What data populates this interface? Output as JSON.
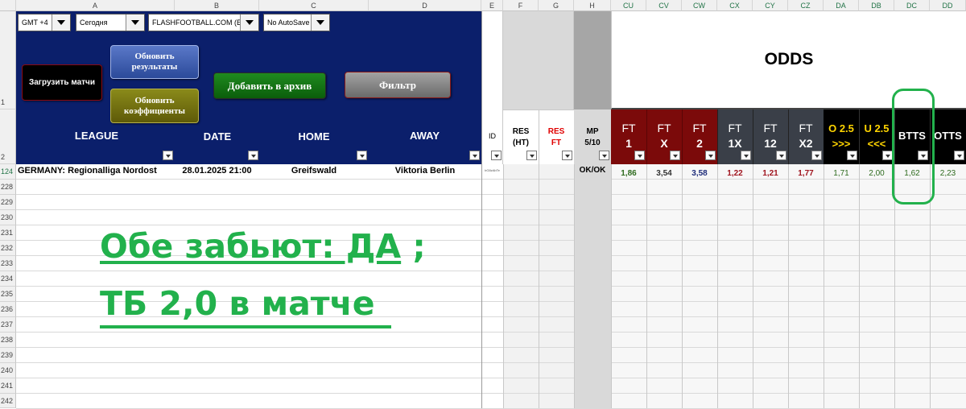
{
  "column_headers": [
    "A",
    "B",
    "C",
    "D",
    "E",
    "F",
    "G",
    "H",
    "CU",
    "CV",
    "CW",
    "CX",
    "CY",
    "CZ",
    "DA",
    "DB",
    "DC",
    "DD"
  ],
  "row_numbers": [
    "1",
    "2",
    "124",
    "228",
    "229",
    "230",
    "231",
    "232",
    "233",
    "234",
    "235",
    "236",
    "237",
    "238",
    "239",
    "240",
    "241",
    "242"
  ],
  "controls": {
    "timezone": "GMT +4",
    "date_filter": "Сегодня",
    "source": "FLASHFOOTBALL.COM (EN)",
    "autosave": "No AutoSave"
  },
  "buttons": {
    "load_matches": "Загрузить матчи",
    "update_results": "Обновить результаты",
    "update_odds": "Обновить коэффициенты",
    "add_archive": "Добавить в архив",
    "filter": "Фильтр"
  },
  "headers": {
    "league": "LEAGUE",
    "date": "DATE",
    "home": "HOME",
    "away": "AWAY",
    "id": "ID",
    "res_ht_1": "RES",
    "res_ht_2": "(HT)",
    "res_ft_1": "RES",
    "res_ft_2": "FT",
    "mp_1": "MP",
    "mp_2": "5/10",
    "odds": "ODDS",
    "ft1_a": "FT",
    "ft1_b": "1",
    "ftx_a": "FT",
    "ftx_b": "X",
    "ft2_a": "FT",
    "ft2_b": "2",
    "ft1x_a": "FT",
    "ft1x_b": "1X",
    "ft12_a": "FT",
    "ft12_b": "12",
    "ftx2_a": "FT",
    "ftx2_b": "X2",
    "o25_a": "O 2.5",
    "o25_b": ">>>",
    "u25_a": "U 2.5",
    "u25_b": "<<<",
    "btts": "BTTS",
    "otts": "OTTS"
  },
  "match": {
    "league": "GERMANY: Regionalliga Nordost",
    "date": "28.01.2025 21:00",
    "home": "Greifswald",
    "away": "Viktoria Berlin",
    "id": "bG8zAbTe",
    "mp": "OK/OK",
    "odds": [
      "1,86",
      "3,54",
      "3,58",
      "1,22",
      "1,21",
      "1,77",
      "1,71",
      "2,00",
      "1,62",
      "2,23"
    ]
  },
  "annotation": {
    "line1": "Обе забьют: ДА",
    "line1_suffix": " ;",
    "line2": "ТБ 2,0 в матче"
  },
  "colors": {
    "navy": "#0b1f6b",
    "dark_red": "#7b0a0a",
    "dark_gray": "#3a3f48",
    "black": "#000000",
    "annotation_green": "#22b14c"
  }
}
